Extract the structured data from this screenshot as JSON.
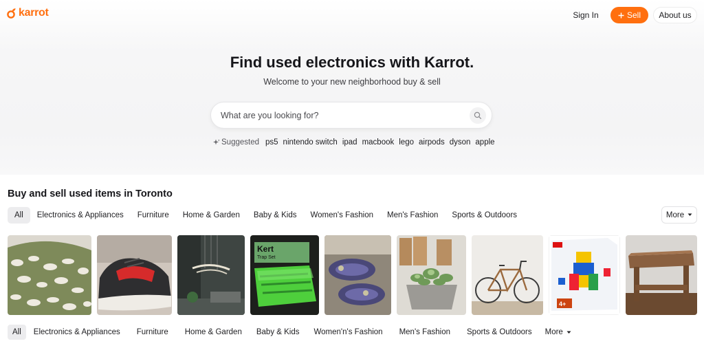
{
  "header": {
    "logo_text": "karrot",
    "sign_in_label": "Sign In",
    "sell_label": "Sell",
    "about_label": "About us"
  },
  "hero": {
    "title": "Find used electronics with Karrot.",
    "subtitle": "Welcome to your new neighborhood buy & sell",
    "search_placeholder": "What are you looking for?",
    "suggested_label": "Suggested",
    "suggestions": [
      "ps5",
      "nintendo switch",
      "ipad",
      "macbook",
      "lego",
      "airpods",
      "dyson",
      "apple"
    ]
  },
  "section": {
    "title": "Buy and sell used items in Toronto",
    "categories": [
      "All",
      "Electronics & Appliances",
      "Furniture",
      "Home & Garden",
      "Baby & Kids",
      "Women's Fashion",
      "Men's Fashion",
      "Sports & Outdoors"
    ],
    "more_label": "More"
  },
  "items": [
    {
      "icon": "rug-image"
    },
    {
      "icon": "sneaker-image"
    },
    {
      "icon": "pendant-lamp-image"
    },
    {
      "icon": "mouse-trap-image"
    },
    {
      "icon": "shoe-soles-image"
    },
    {
      "icon": "succulent-plant-image"
    },
    {
      "icon": "bicycle-image"
    },
    {
      "icon": "lego-box-image"
    },
    {
      "icon": "coffee-table-image"
    }
  ],
  "footer_categories": {
    "items": [
      "All",
      "Electronics & Appliances",
      "Furniture",
      "Home & Garden",
      "Baby & Kids",
      "Women'n's Fashion",
      "Men's Fashion",
      "Sports & Outdoors"
    ],
    "more_label": "More"
  },
  "colors": {
    "brand": "#ff6f0f",
    "chip_active": "#ececee",
    "text": "#212124"
  },
  "lego_badge": "4+"
}
